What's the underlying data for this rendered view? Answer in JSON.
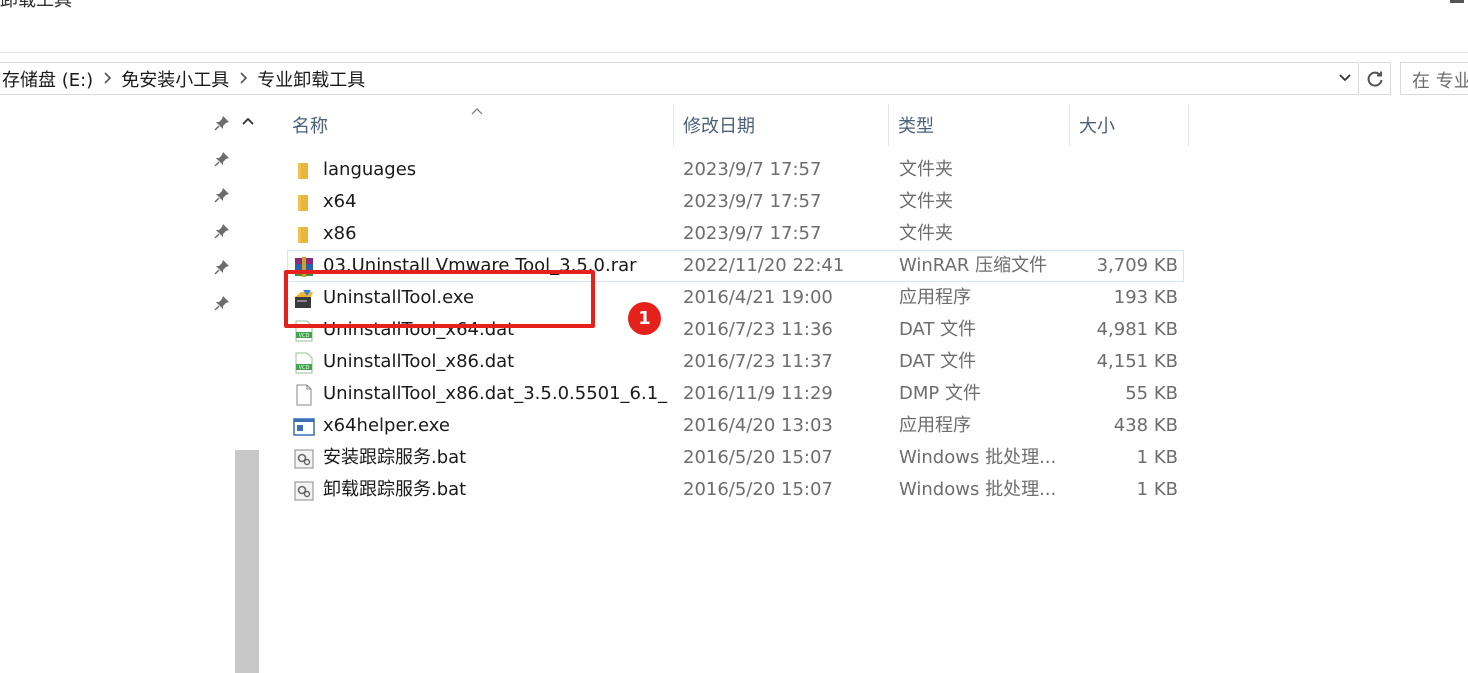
{
  "window": {
    "title_fragment": "卸载工具"
  },
  "address": {
    "crumbs": [
      "存储盘 (E:)",
      "免安装小工具",
      "专业卸载工具"
    ],
    "search_placeholder": "在 专业"
  },
  "columns": {
    "name": "名称",
    "date": "修改日期",
    "type": "类型",
    "size": "大小"
  },
  "files": [
    {
      "icon": "folder-icon",
      "name": "languages",
      "date": "2023/9/7 17:57",
      "type": "文件夹",
      "size": ""
    },
    {
      "icon": "folder-icon",
      "name": "x64",
      "date": "2023/9/7 17:57",
      "type": "文件夹",
      "size": ""
    },
    {
      "icon": "folder-icon",
      "name": "x86",
      "date": "2023/9/7 17:57",
      "type": "文件夹",
      "size": ""
    },
    {
      "icon": "winrar-archive-icon",
      "name": "03.Uninstall Vmware Tool_3.5.0.rar",
      "date": "2022/11/20 22:41",
      "type": "WinRAR 压缩文件",
      "size": "3,709 KB"
    },
    {
      "icon": "uninstalltool-app-icon",
      "name": "UninstallTool.exe",
      "date": "2016/4/21 19:00",
      "type": "应用程序",
      "size": "193 KB"
    },
    {
      "icon": "vcd-file-icon",
      "name": "UninstallTool_x64.dat",
      "date": "2016/7/23 11:36",
      "type": "DAT 文件",
      "size": "4,981 KB"
    },
    {
      "icon": "vcd-file-icon",
      "name": "UninstallTool_x86.dat",
      "date": "2016/7/23 11:37",
      "type": "DAT 文件",
      "size": "4,151 KB"
    },
    {
      "icon": "blank-file-icon",
      "name": "UninstallTool_x86.dat_3.5.0.5501_6.1_...",
      "date": "2016/11/9 11:29",
      "type": "DMP 文件",
      "size": "55 KB"
    },
    {
      "icon": "exe-app-icon",
      "name": "x64helper.exe",
      "date": "2016/4/20 13:03",
      "type": "应用程序",
      "size": "438 KB"
    },
    {
      "icon": "batch-file-icon",
      "name": "安装跟踪服务.bat",
      "date": "2016/5/20 15:07",
      "type": "Windows 批处理...",
      "size": "1 KB"
    },
    {
      "icon": "batch-file-icon",
      "name": "卸载跟踪服务.bat",
      "date": "2016/5/20 15:07",
      "type": "Windows 批处理...",
      "size": "1 KB"
    }
  ],
  "annotation": {
    "badge": "1",
    "color": "#e6201b"
  },
  "colors": {
    "hover_border": "#cce8ff",
    "header_text": "#4c607a",
    "folder": "#f2c14e"
  }
}
